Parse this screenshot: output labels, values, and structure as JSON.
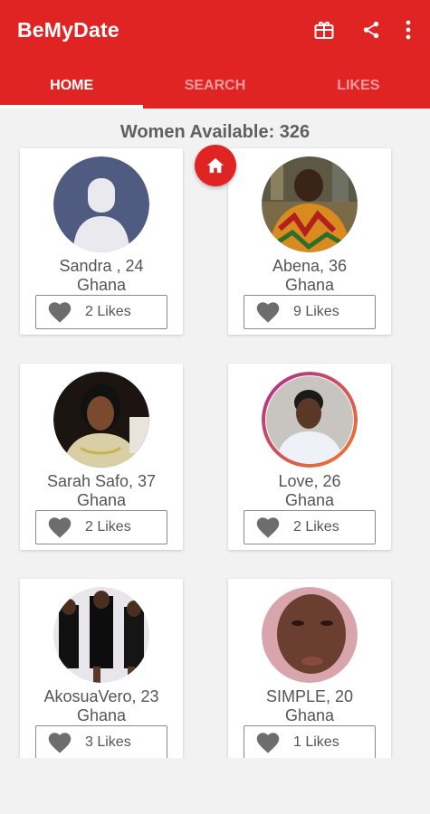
{
  "app": {
    "title": "BeMyDate",
    "accent": "#e02424",
    "actions": [
      "gift-icon",
      "share-icon",
      "more-vert-icon"
    ]
  },
  "tabs": [
    {
      "label": "HOME",
      "active": true
    },
    {
      "label": "SEARCH",
      "active": false
    },
    {
      "label": "LIKES",
      "active": false
    }
  ],
  "count_text": "Women Available: 326",
  "profiles": [
    {
      "name": "Sandra , 24",
      "country": "Ghana",
      "likes": "2 Likes",
      "photo": "default-avatar"
    },
    {
      "name": "Abena, 36",
      "country": "Ghana",
      "likes": "9 Likes",
      "photo": "photo"
    },
    {
      "name": "Sarah Safo, 37",
      "country": "Ghana",
      "likes": "2 Likes",
      "photo": "photo"
    },
    {
      "name": "Love, 26",
      "country": "Ghana",
      "likes": "2 Likes",
      "photo": "photo"
    },
    {
      "name": "AkosuaVero, 23",
      "country": "Ghana",
      "likes": "3 Likes",
      "photo": "photo"
    },
    {
      "name": "SIMPLE, 20",
      "country": "Ghana",
      "likes": "1 Likes",
      "photo": "photo"
    }
  ]
}
